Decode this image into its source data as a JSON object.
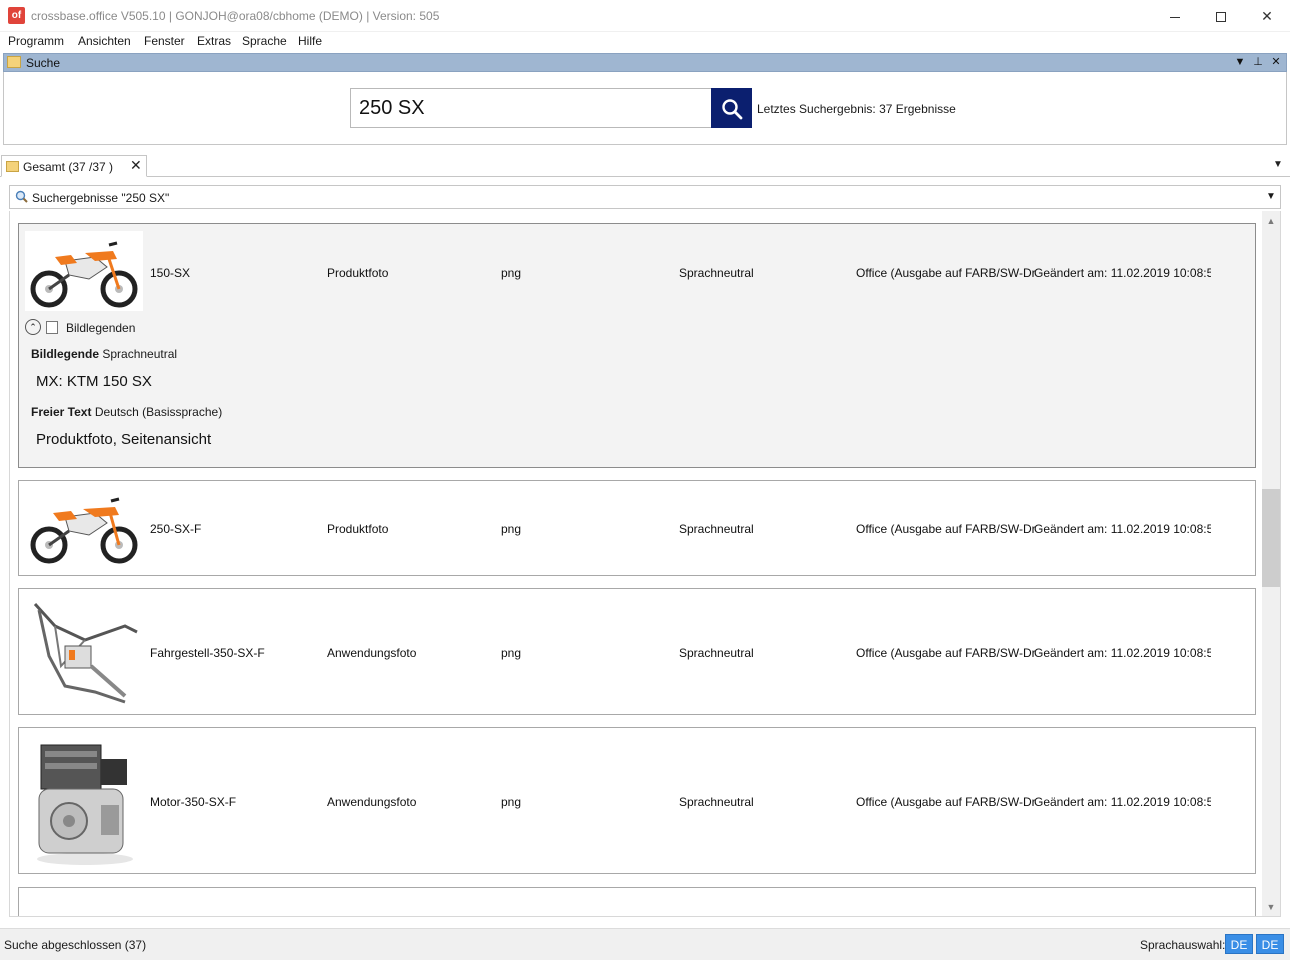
{
  "window": {
    "app_icon": "of",
    "title": "crossbase.office  V505.10 | GONJOH@ora08/cbhome (DEMO) | Version: 505",
    "minimize_icon": "minimize-icon",
    "maximize_icon": "maximize-icon",
    "close_icon": "close-icon",
    "close_glyph": "✕"
  },
  "menu": {
    "items": [
      "Programm",
      "Ansichten",
      "Fenster",
      "Extras",
      "Sprache",
      "Hilfe"
    ]
  },
  "search_panel": {
    "title": "Suche",
    "dropdown_glyph": "▼",
    "pin_glyph": "⊥",
    "close_glyph": "✕",
    "query": "250 SX",
    "last_result": "Letztes Suchergebnis: 37 Ergebnisse"
  },
  "tab": {
    "label": "Gesamt (37 /37 )",
    "close_glyph": "✕",
    "menu_glyph": "▼"
  },
  "results": {
    "header": "Suchergebnisse \"250 SX\"",
    "dropdown_glyph": "▼",
    "scroll_up_glyph": "▲",
    "scroll_down_glyph": "▼",
    "items": [
      {
        "name": "150-SX",
        "type": "Produktfoto",
        "format": "png",
        "language": "Sprachneutral",
        "office": "Office (Ausgabe auf FARB/SW-Dr",
        "changed": "Geändert am:  11.02.2019 10:08:5",
        "legend_toggle_glyph": "⌃",
        "legend_label": "Bildlegenden",
        "legend_title": "Bildlegende",
        "legend_lang": "Sprachneutral",
        "legend_value": "MX: KTM 150 SX",
        "free_text_title": "Freier Text",
        "free_text_lang": "Deutsch (Basissprache)",
        "free_text_value": "Produktfoto, Seitenansicht"
      },
      {
        "name": "250-SX-F",
        "type": "Produktfoto",
        "format": "png",
        "language": "Sprachneutral",
        "office": "Office (Ausgabe auf FARB/SW-Dr",
        "changed": "Geändert am:  11.02.2019 10:08:5"
      },
      {
        "name": "Fahrgestell-350-SX-F",
        "type": "Anwendungsfoto",
        "format": "png",
        "language": "Sprachneutral",
        "office": "Office (Ausgabe auf FARB/SW-Dr",
        "changed": "Geändert am:  11.02.2019 10:08:5"
      },
      {
        "name": "Motor-350-SX-F",
        "type": "Anwendungsfoto",
        "format": "png",
        "language": "Sprachneutral",
        "office": "Office (Ausgabe auf FARB/SW-Dr",
        "changed": "Geändert am:  11.02.2019 10:08:5"
      }
    ]
  },
  "status": {
    "text": "Suche abgeschlossen (37)",
    "lang_label": "Sprachauswahl:",
    "lang_buttons": [
      "DE",
      "DE"
    ]
  },
  "colors": {
    "panel_header": "#9fb6d1",
    "search_button": "#0b1f6f",
    "lang_button": "#3a8ee6",
    "bike_orange": "#f07a1e"
  }
}
